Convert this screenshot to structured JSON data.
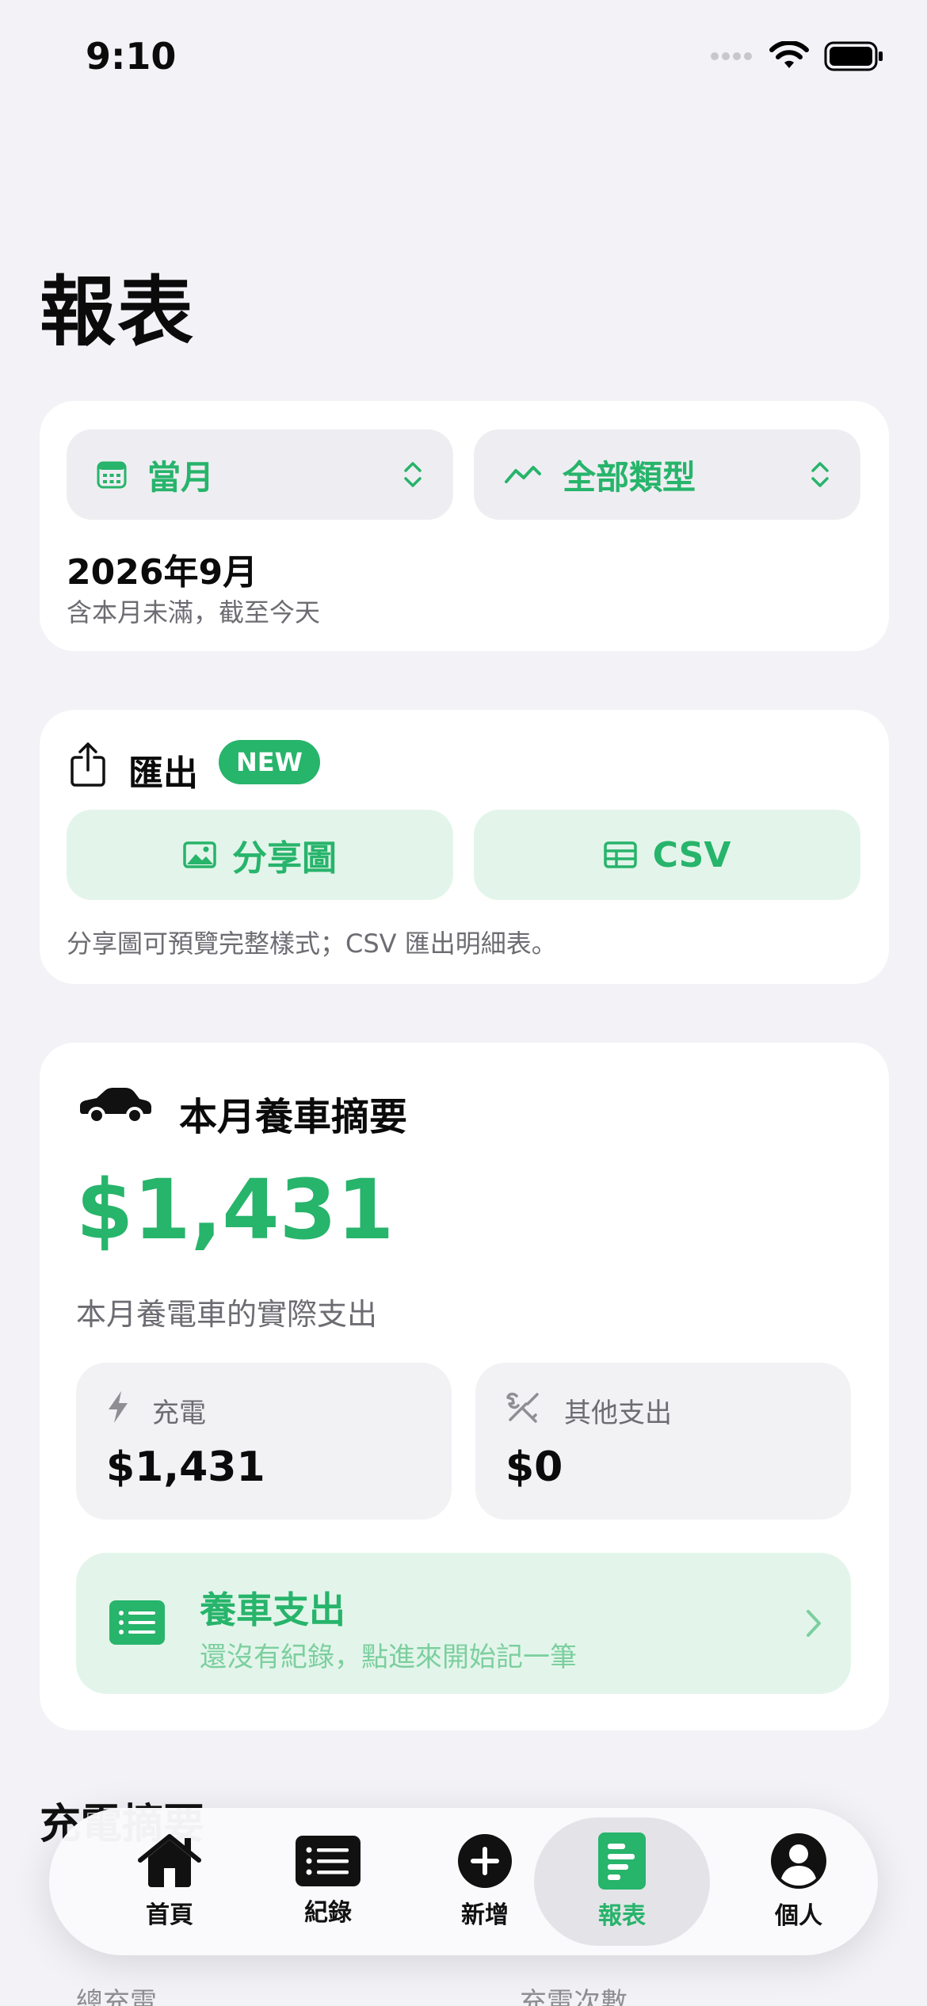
{
  "status": {
    "time": "9:10"
  },
  "page": {
    "title": "報表"
  },
  "filters": {
    "period_label": "當月",
    "type_label": "全部類型",
    "date_title": "2026年9月",
    "date_note": "含本月未滿，截至今天"
  },
  "export": {
    "title": "匯出",
    "badge": "NEW",
    "share_label": "分享圖",
    "csv_label": "CSV",
    "hint": "分享圖可預覽完整樣式；CSV 匯出明細表。"
  },
  "summary": {
    "title": "本月養車摘要",
    "total": "$1,431",
    "subtitle": "本月養電車的實際支出",
    "charging_label": "充電",
    "charging_value": "$1,431",
    "other_label": "其他支出",
    "other_value": "$0",
    "expense_title": "養車支出",
    "expense_subtitle": "還沒有紀錄，點進來開始記一筆"
  },
  "next_section": {
    "title": "充電摘要",
    "left_label": "總充電",
    "right_label": "充電次數"
  },
  "tabbar": {
    "home": "首頁",
    "records": "紀錄",
    "add": "新增",
    "reports": "報表",
    "profile": "個人"
  },
  "colors": {
    "accent": "#27b46b",
    "accent_light": "#e3f5ea",
    "background": "#f2f2f7"
  }
}
